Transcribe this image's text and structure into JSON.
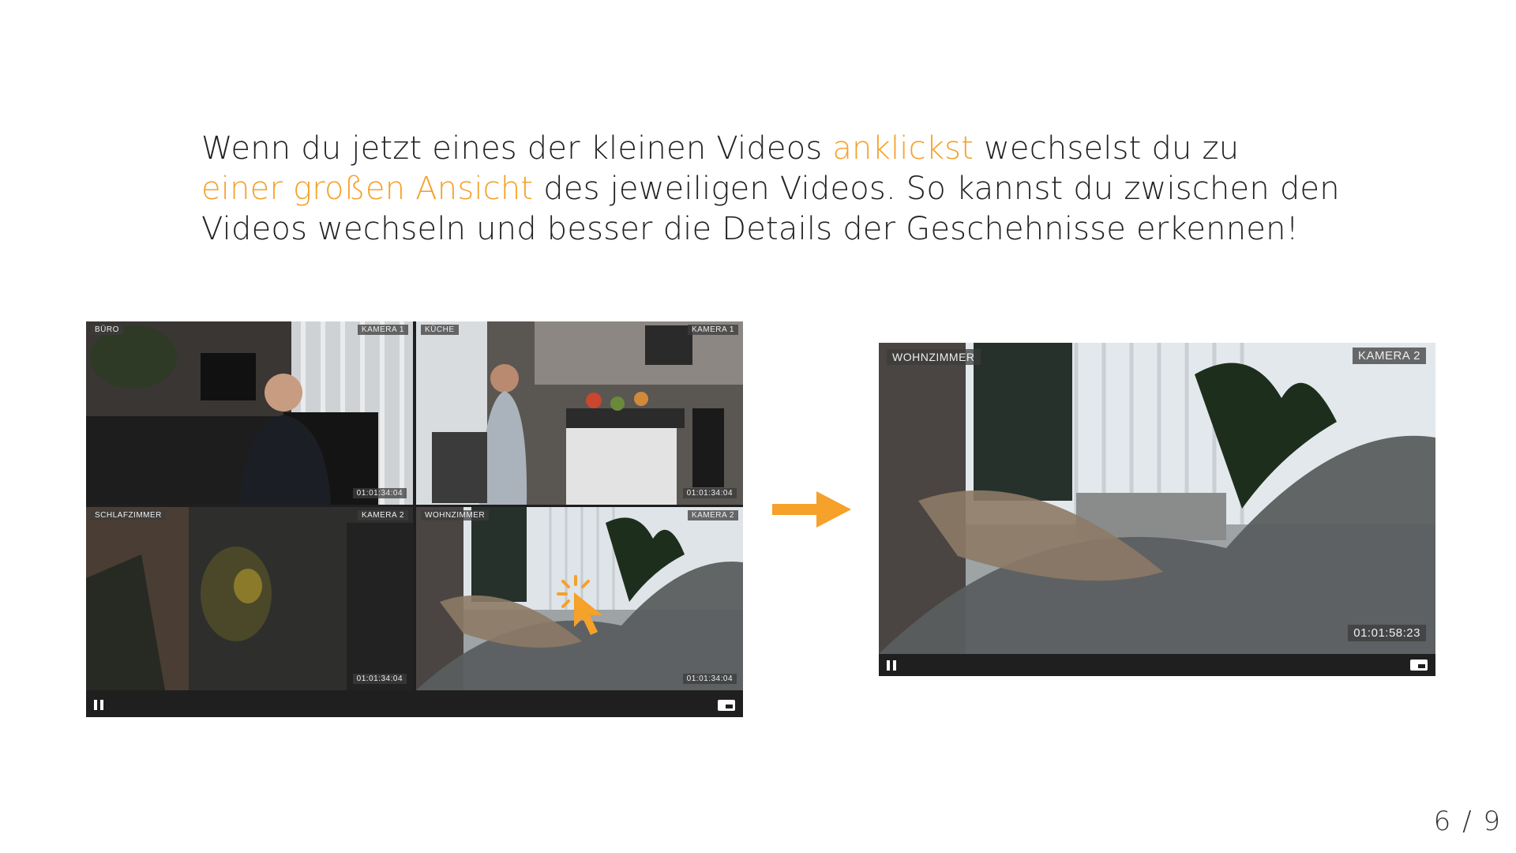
{
  "intro": {
    "line1_a": "Wenn du jetzt eines der kleinen Videos ",
    "line1_hl": "anklickst",
    "line1_b": " wechselst du zu",
    "line2_hl": "einer großen Ansicht",
    "line2_b": " des jeweiligen Videos. So kannst du zwischen den",
    "line3": "Videos wechseln und besser die Details der Geschehnisse erkennen!"
  },
  "grid_player": {
    "tiles": [
      {
        "room": "BÜRO",
        "camera": "KAMERA 1",
        "time": "01:01:34:04"
      },
      {
        "room": "KÜCHE",
        "camera": "KAMERA 1",
        "time": "01:01:34:04"
      },
      {
        "room": "SCHLAFZIMMER",
        "camera": "KAMERA 2",
        "time": "01:01:34:04"
      },
      {
        "room": "WOHNZIMMER",
        "camera": "KAMERA 2",
        "time": "01:01:34:04"
      }
    ]
  },
  "single_player": {
    "room": "WOHNZIMMER",
    "camera": "KAMERA 2",
    "time": "01:01:58:23"
  },
  "pager": "6 / 9",
  "colors": {
    "accent": "#f5a12a",
    "player_bg": "#1f1f1f"
  },
  "icons": [
    "pause-icon",
    "layout-icon",
    "cursor-click-icon",
    "arrow-right-icon"
  ]
}
